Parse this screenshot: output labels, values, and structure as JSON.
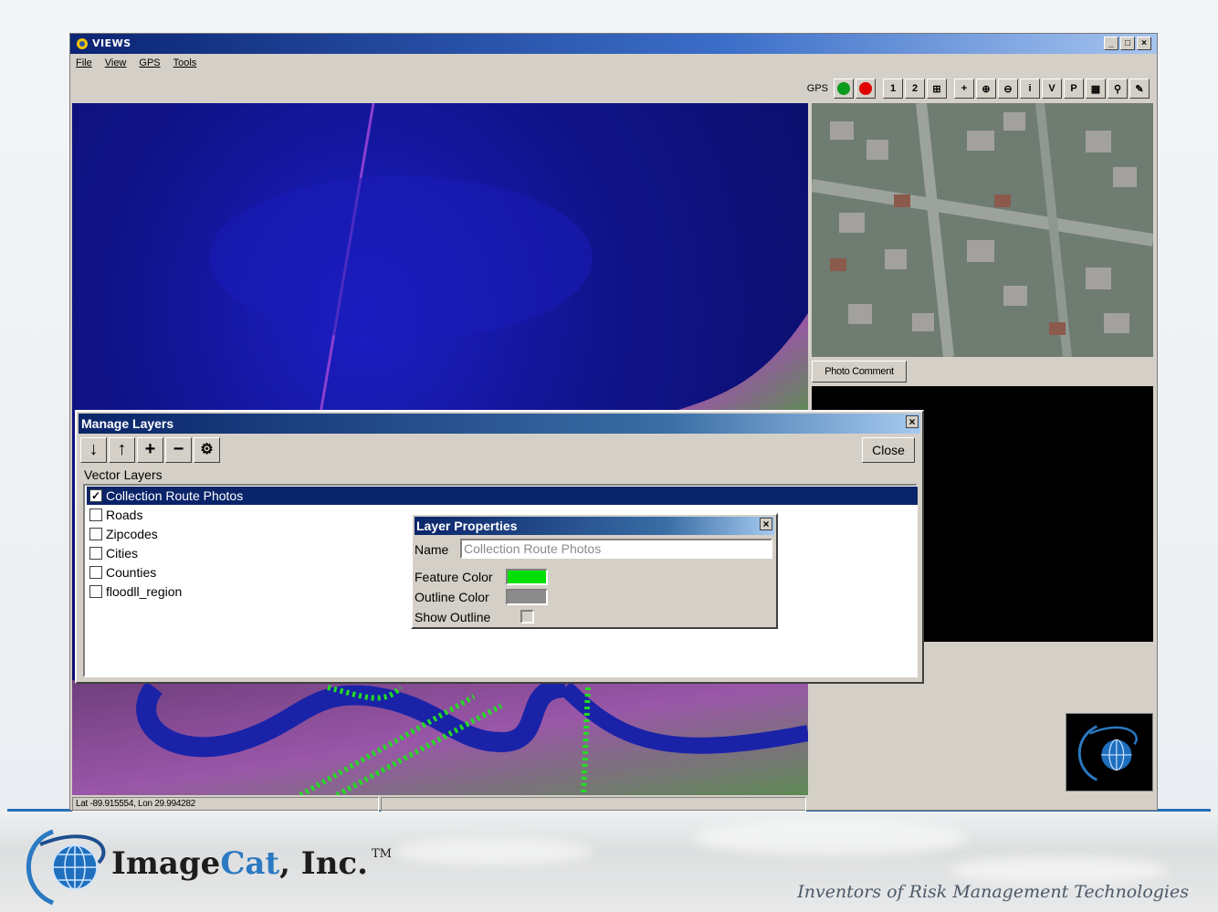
{
  "window": {
    "title": "VIEWS",
    "controls": [
      "_",
      "□",
      "×"
    ]
  },
  "menu": [
    "File",
    "View",
    "GPS",
    "Tools"
  ],
  "toolbar": {
    "gps_label": "GPS",
    "buttons": [
      {
        "icon": "gps-start-icon",
        "color": "#0a9a1e"
      },
      {
        "icon": "gps-stop-icon",
        "color": "#e00000"
      },
      {
        "icon": "view-1-icon",
        "glyph": "1"
      },
      {
        "icon": "view-2-icon",
        "glyph": "2"
      },
      {
        "icon": "view-split-icon",
        "glyph": "⊞"
      },
      {
        "icon": "pan-icon",
        "glyph": "+"
      },
      {
        "icon": "zoom-in-icon",
        "glyph": "⊕"
      },
      {
        "icon": "zoom-out-icon",
        "glyph": "⊖"
      },
      {
        "icon": "info-icon",
        "glyph": "i"
      },
      {
        "icon": "v-icon",
        "glyph": "V"
      },
      {
        "icon": "p-icon",
        "glyph": "P"
      },
      {
        "icon": "grid-icon",
        "glyph": "▦"
      },
      {
        "icon": "pin-icon",
        "glyph": "⚲"
      },
      {
        "icon": "edit-icon",
        "glyph": "✎"
      }
    ]
  },
  "status": {
    "coords": "Lat -89.915554, Lon 29.994282",
    "extra": ""
  },
  "photo_panel": {
    "comment_button": "Photo Comment"
  },
  "manage_layers": {
    "title": "Manage Layers",
    "close_label": "Close",
    "tools": [
      "↓",
      "↑",
      "+",
      "−",
      "⚙"
    ],
    "section_label": "Vector Layers",
    "layers": [
      {
        "name": "Collection Route Photos",
        "checked": true,
        "selected": true
      },
      {
        "name": "Roads",
        "checked": false,
        "selected": false
      },
      {
        "name": "Zipcodes",
        "checked": false,
        "selected": false
      },
      {
        "name": "Cities",
        "checked": false,
        "selected": false
      },
      {
        "name": "Counties",
        "checked": false,
        "selected": false
      },
      {
        "name": "floodll_region",
        "checked": false,
        "selected": false
      }
    ]
  },
  "layer_properties": {
    "title": "Layer Properties",
    "name_label": "Name",
    "name_value": "Collection Route Photos",
    "feature_color_label": "Feature Color",
    "feature_color": "#00e000",
    "outline_color_label": "Outline Color",
    "outline_color": "#8c8c8c",
    "show_outline_label": "Show Outline",
    "show_outline": false
  },
  "branding": {
    "company_prefix": "Image",
    "company_accent": "Cat",
    "company_suffix": ", Inc.",
    "trademark": "TM",
    "tagline": "Inventors of Risk Management Technologies"
  }
}
